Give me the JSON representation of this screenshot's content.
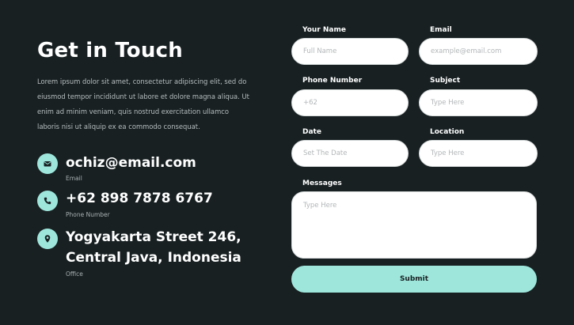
{
  "header": {
    "title": "Get in Touch",
    "description": "Lorem ipsum dolor sit amet, consectetur adipiscing elit, sed do eiusmod tempor incididunt ut labore et dolore magna aliqua. Ut enim ad minim veniam, quis nostrud exercitation ullamco laboris nisi ut aliquip ex ea commodo consequat."
  },
  "contacts": {
    "email": {
      "value": "ochiz@email.com",
      "label": "Email",
      "icon": "envelope-icon"
    },
    "phone": {
      "value": "+62 898 7878 6767",
      "label": "Phone Number",
      "icon": "phone-icon"
    },
    "address": {
      "line1": "Yogyakarta Street 246,",
      "line2": "Central Java, Indonesia",
      "label": "Office",
      "icon": "location-pin-icon"
    }
  },
  "form": {
    "name": {
      "label": "Your Name",
      "placeholder": "Full Name"
    },
    "email": {
      "label": "Email",
      "placeholder": "example@email.com"
    },
    "phone": {
      "label": "Phone Number",
      "placeholder": "+62"
    },
    "subject": {
      "label": "Subject",
      "placeholder": "Type Here"
    },
    "date": {
      "label": "Date",
      "placeholder": "Set The Date"
    },
    "location": {
      "label": "Location",
      "placeholder": "Type Here"
    },
    "messages": {
      "label": "Messages",
      "placeholder": "Type Here"
    },
    "submit_label": "Submit"
  },
  "colors": {
    "background": "#182022",
    "accent": "#9ee6dc",
    "text": "#ffffff",
    "muted": "#b7bdbf"
  }
}
